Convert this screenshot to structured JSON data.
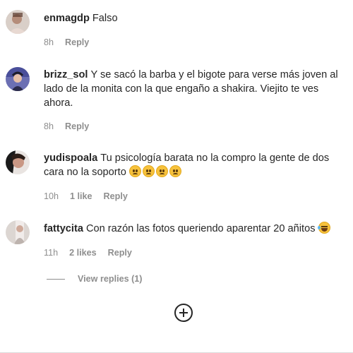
{
  "comments": [
    {
      "username": "enmagdp",
      "text": "Falso",
      "time": "8h",
      "likes": "",
      "reply_label": "Reply"
    },
    {
      "username": "brizz_sol",
      "text": "Y se sacó la barba y el bigote para verse más joven al lado de la monita con la que engaño a shakira. Viejito te ves ahora.",
      "time": "8h",
      "likes": "",
      "reply_label": "Reply"
    },
    {
      "username": "yudispoala",
      "text": "Tu psicología barata no la compro la gente de dos cara no la soporto",
      "emojis": [
        "sad-face",
        "sad-face",
        "sad-face",
        "sad-face"
      ],
      "time": "10h",
      "likes": "1 like",
      "reply_label": "Reply"
    },
    {
      "username": "fattycita",
      "text": "Con razón las fotos queriendo aparentar 20 añitos",
      "emojis": [
        "laughing-tears-face"
      ],
      "time": "11h",
      "likes": "2 likes",
      "reply_label": "Reply"
    }
  ],
  "view_replies_label": "View replies (1)",
  "add_icon": "plus-circle-icon"
}
